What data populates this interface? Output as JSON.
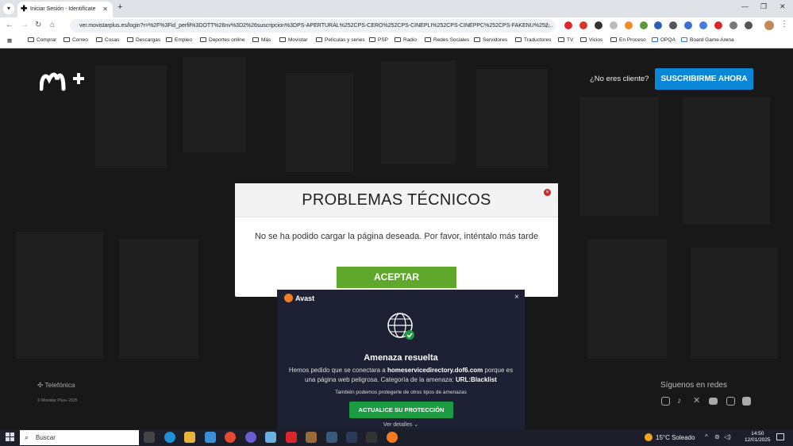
{
  "browser": {
    "tab_title": "Iniciar Sesión - Identifícate",
    "tab_favicon": "✚",
    "url": "ver.movistarplus.es/login?r=%2F%3Fid_perfil%3DOTT%26nv%3D2%26suscripcion%3DPS-APERTURAL%252CPS-CERO%252CPS-CINEPLI%252CPS-CINEPPC%252CPS-FAKENU%252..."
  },
  "bookmarks": [
    "Comprar",
    "Correo",
    "Cosas",
    "Descargas",
    "Empleo",
    "Deportes online",
    "Más",
    "Movistar",
    "Películas y series",
    "PSP",
    "Radio",
    "Redes Sociales",
    "Servidores",
    "Traductores",
    "TV",
    "Vicios",
    "En Proceso",
    "OPQA",
    "Board Game Arena"
  ],
  "header": {
    "no_client": "¿No eres cliente?",
    "subscribe": "SUSCRIBIRME AHORA"
  },
  "modal": {
    "title": "PROBLEMAS TÉCNICOS",
    "message": "No se ha podido cargar la página deseada. Por favor, inténtalo más tarde",
    "accept": "ACEPTAR",
    "close": "×"
  },
  "footer": {
    "brand": "Telefónica",
    "copyright": "© Movistar Plus+ 2025",
    "social_title": "Síguenos en redes",
    "social_icons": [
      "instagram-icon",
      "tiktok-icon",
      "x-icon",
      "youtube-icon",
      "twitch-icon",
      "facebook-icon"
    ]
  },
  "avast": {
    "brand": "Avast",
    "title": "Amenaza resuelta",
    "body_pre": "Hemos pedido que se conectara a ",
    "domain": "homeservicedirectory.dof6.com",
    "body_mid": " porque es una página web peligrosa. Categoría de la amenaza: ",
    "category": "URL:Blacklist",
    "small": "También podemos protegerle de otros tipos de amenazas",
    "button": "ACTUALICE SU PROTECCIÓN",
    "details": "Ver detalles ⌄",
    "close": "×"
  },
  "taskbar": {
    "search_placeholder": "Buscar",
    "weather": "15°C  Soleado",
    "time": "14:50",
    "date": "12/01/2025"
  },
  "colors": {
    "accent_blue": "#0b87d7",
    "accept_green": "#5fa82b",
    "avast_green": "#1b9c43",
    "avast_bg": "#1e2134"
  }
}
